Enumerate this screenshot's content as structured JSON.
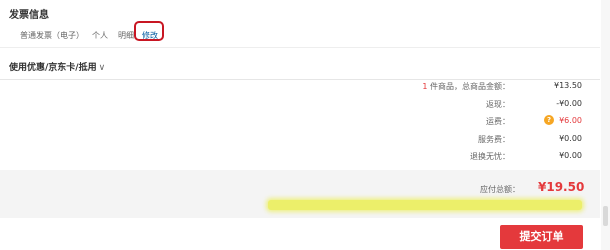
{
  "invoice": {
    "section_title": "发票信息",
    "type": "普通发票（电子）",
    "title": "个人",
    "content": "明细",
    "modify_label": "修改"
  },
  "coupon": {
    "label": "使用优惠/京东卡/抵用",
    "chevron": "∨"
  },
  "summary": {
    "items_count": "1",
    "items_text": "件商品，总商品金额：",
    "items_amount": "¥13.50",
    "rebate_label": "返现：",
    "rebate_value": "-¥0.00",
    "freight_label": "运费：",
    "freight_icon": "?",
    "freight_value": "¥6.00",
    "service_label": "服务费：",
    "service_value": "¥0.00",
    "return_label": "退换无忧：",
    "return_value": "¥0.00"
  },
  "total": {
    "label": "应付总额：",
    "value": "¥19.50"
  },
  "submit_label": "提交订单",
  "colors": {
    "accent": "#e4393c",
    "link": "#005aa0",
    "highlight": "#ecef6a"
  }
}
